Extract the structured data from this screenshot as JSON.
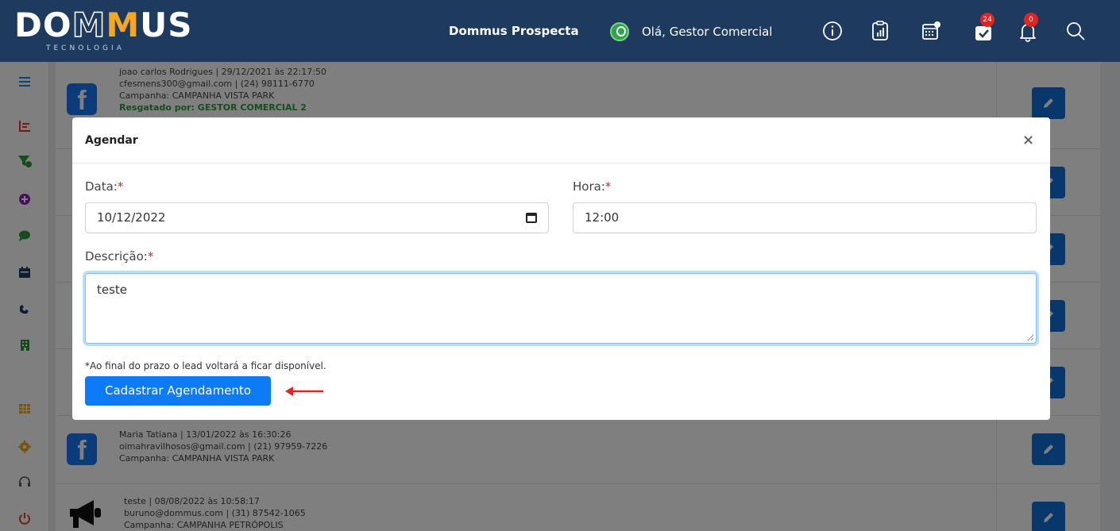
{
  "header": {
    "logo_text": "DOMMUS",
    "logo_subtitle": "TECNOLOGIA",
    "app_title": "Dommus Prospecta",
    "greeting": "Olá, Gestor Comercial",
    "tasks_badge": "24",
    "notifications_badge": "0"
  },
  "sidebar": {
    "icons": [
      "menu-icon",
      "chart-icon",
      "filter-icon",
      "plus-circle-icon",
      "chat-icon",
      "calendar-icon",
      "phone-icon",
      "building-icon",
      "grid-icon",
      "gear-icon",
      "headset-icon",
      "power-icon"
    ]
  },
  "background_rows": [
    {
      "line1": "joao carlos Rodrigues | 29/12/2021 às 22:17:50",
      "line2": "cfesmens300@gmail.com | (24) 98111-6770",
      "line3": "Campanha: CAMPANHA VISTA PARK",
      "line4": "Resgatado por: GESTOR COMERCIAL 2"
    },
    {
      "line1": "Maria Tatiana | 13/01/2022 às 16:30:26",
      "line2": "oimahravilhosos@gmail.com | (21) 97959-7226",
      "line3": "Campanha: CAMPANHA VISTA PARK"
    },
    {
      "line1": "teste | 08/08/2022 às 10:58:17",
      "line2": "buruno@dommus.com | (31) 87542-1065",
      "line3": "Campanha: CAMPANHA PETRÓPOLIS"
    }
  ],
  "modal": {
    "title": "Agendar",
    "close": "×",
    "date_label": "Data:",
    "date_value": "10/12/2022",
    "time_label": "Hora:",
    "time_value": "12:00",
    "description_label": "Descrição:",
    "description_value": "teste",
    "required_mark": "*",
    "note": "*Ao final do prazo o lead voltará a ficar disponível.",
    "submit_label": "Cadastrar Agendamento"
  },
  "colors": {
    "topbar": "#1e3a5f",
    "primary_button": "#0d7bf5",
    "required": "#e02424",
    "arrow": "#e02424"
  }
}
